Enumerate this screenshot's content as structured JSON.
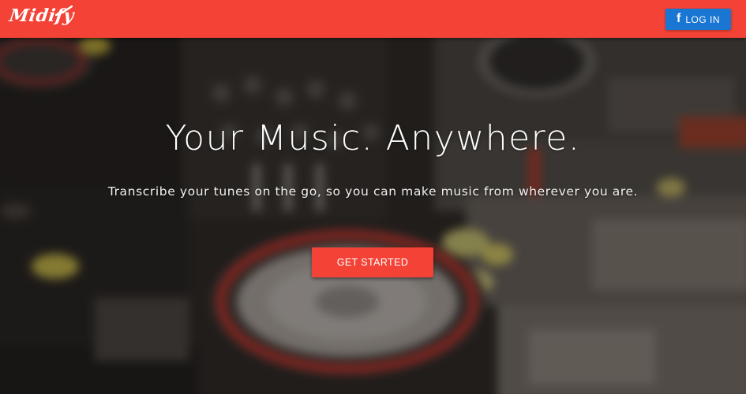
{
  "navbar": {
    "logo_text": "Midify",
    "login_label": "LOG IN",
    "login_icon": "facebook-icon",
    "brand_color": "#f44336",
    "login_color": "#1976d2"
  },
  "hero": {
    "title": "Your Music. Anywhere.",
    "subtitle": "Transcribe your tunes on the go, so you can make music from wherever you are.",
    "cta_label": "GET STARTED",
    "background_image": "blurred-dj-mixer-photo"
  }
}
